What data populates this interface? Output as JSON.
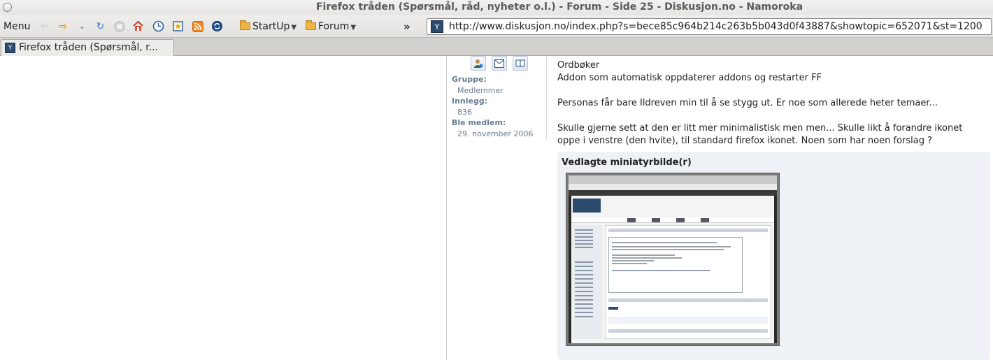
{
  "window": {
    "title": "Firefox tråden (Spørsmål, råd, nyheter o.l.) - Forum - Side 25 - Diskusjon.no - Namoroka"
  },
  "toolbar": {
    "menu_label": "Menu",
    "bookmarks": [
      {
        "label": "StartUp",
        "icon": "folder-icon"
      },
      {
        "label": "Forum",
        "icon": "folder-icon"
      }
    ],
    "overflow_label": "»",
    "nav_icons": [
      "back-icon",
      "forward-icon",
      "history-dropdown-icon",
      "reload-icon",
      "stop-icon",
      "home-icon",
      "clock-icon",
      "bookmark-icon",
      "rss-icon",
      "sync-icon"
    ],
    "url": "http://www.diskusjon.no/index.php?s=bece85c964b214c263b5b043d0f43887&showtopic=652071&st=1200"
  },
  "tabs": [
    {
      "label": "Firefox tråden (Spørsmål, r..."
    }
  ],
  "user": {
    "group_label": "Gruppe:",
    "group_value": "Medlemmer",
    "posts_label": "Innlegg:",
    "posts_value": "836",
    "member_since_label": "Ble medlem:",
    "member_since_value": "29. november 2006",
    "icons": [
      "profile-icon",
      "message-icon",
      "blog-icon"
    ]
  },
  "post": {
    "lines": [
      "Ordbøker",
      "Addon som automatisk oppdaterer addons og restarter FF",
      "",
      "Personas får bare Ildreven min til å se stygg ut. Er noe som allerede heter temaer...",
      "",
      "Skulle gjerne sett at den er litt mer minimalistisk men men... Skulle likt å forandre ikonet oppe i venstre (den hvite), til standard firefox ikonet. Noen som har noen forslag ?"
    ]
  },
  "attachment": {
    "title": "Vedlagte miniatyrbilde(r)"
  },
  "colors": {
    "accent": "#2c4a6e",
    "user_label": "#6a7d93",
    "attach_bg": "#eef1f5"
  }
}
